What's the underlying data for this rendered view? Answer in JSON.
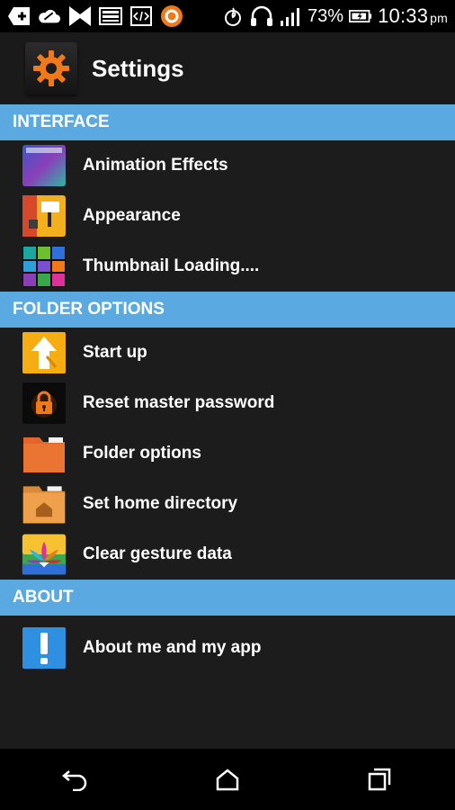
{
  "status_bar": {
    "battery": "73%",
    "time": "10:33",
    "ampm": "pm",
    "left_icons": [
      "add-icon",
      "cloud-icon",
      "app-icon",
      "image-icon",
      "code-icon",
      "orange-app-icon"
    ],
    "right_icons": [
      "flame-icon",
      "headphones-icon",
      "signal-icon",
      "battery-icon"
    ]
  },
  "app_bar": {
    "title": "Settings",
    "icon": "gear-icon",
    "accent": "#f07a1a"
  },
  "sections": [
    {
      "header": "INTERFACE",
      "items": [
        {
          "label": "Animation Effects",
          "icon": "animation-icon"
        },
        {
          "label": "Appearance",
          "icon": "appearance-icon"
        },
        {
          "label": "Thumbnail Loading....",
          "icon": "thumbnail-icon"
        }
      ]
    },
    {
      "header": "FOLDER OPTIONS",
      "items": [
        {
          "label": "Start up",
          "icon": "startup-arrow-icon"
        },
        {
          "label": "Reset master password",
          "icon": "lock-icon"
        },
        {
          "label": "Folder options",
          "icon": "folder-icon"
        },
        {
          "label": "Set home directory",
          "icon": "home-folder-icon"
        },
        {
          "label": "Clear gesture data",
          "icon": "gesture-icon"
        }
      ]
    },
    {
      "header": "ABOUT",
      "items": [
        {
          "label": "About me and my app",
          "icon": "info-icon"
        }
      ]
    }
  ],
  "colors": {
    "section_header": "#5aa9e0",
    "background": "#1c1c1c"
  },
  "nav_bar": {
    "icons": [
      "back-icon",
      "home-icon",
      "recents-icon"
    ]
  }
}
